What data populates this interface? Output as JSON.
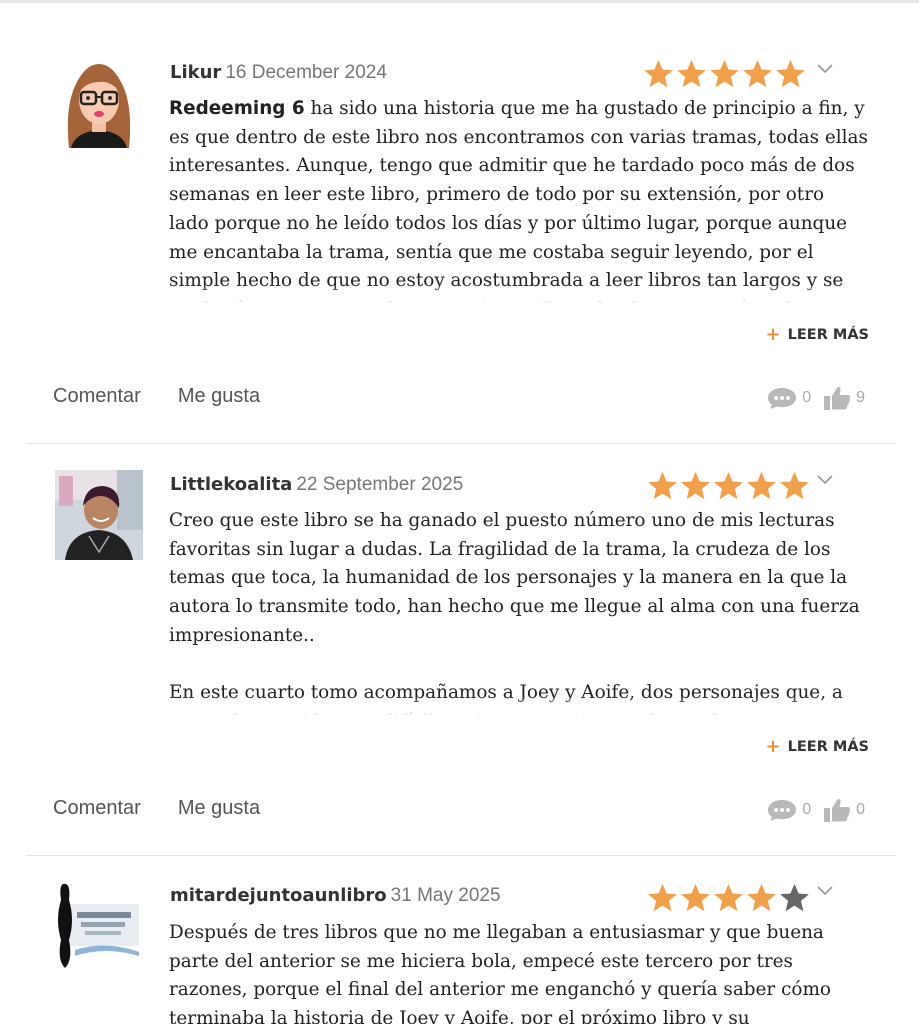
{
  "colors": {
    "star_filled": "#f0a04b",
    "star_empty": "#666666",
    "accent": "#e8913a"
  },
  "reviews": [
    {
      "user": "Likur",
      "date": "16 December 2024",
      "rating": 5,
      "bold_lead": "Redeeming 6",
      "paragraphs": [
        " ha sido una historia que me ha gustado de principio a fin, y es que dentro de este libro nos encontramos con varias tramas, todas ellas interesantes. Aunque, tengo que admitir que he tardado poco más de dos semanas en leer este libro, primero de todo por su extensión, por otro lado porque no he leído todos los días y por último lugar, porque aunque me encantaba la trama, sentía que me costaba seguir leyendo, por el simple hecho de que no estoy acostumbrada a leer libros tan largos y se me hacía un poco pesado en ocasiones. De todas formas, a mí me ha gustado mucho el libro."
      ],
      "read_more": "LEER MÁS",
      "comment_label": "Comentar",
      "like_label": "Me gusta",
      "comments": "0",
      "likes": "9"
    },
    {
      "user": "Littlekoalita",
      "date": "22 September 2025",
      "rating": 5,
      "bold_lead": "",
      "paragraphs": [
        "Creo que este libro se ha ganado el puesto número uno de mis lecturas favoritas sin lugar a dudas. La fragilidad de la trama, la crudeza de los temas que toca, la humanidad de los personajes y la manera en la que la autora lo transmite todo, han hecho que me llegue al alma con una fuerza impresionante..",
        "En este cuarto tomo acompañamos a Joey y Aoife, dos personajes que, a pesar de sus vidas tan difíciles, siempre se tienen el uno al otro."
      ],
      "read_more": "LEER MÁS",
      "comment_label": "Comentar",
      "like_label": "Me gusta",
      "comments": "0",
      "likes": "0"
    },
    {
      "user": "mitardejuntoaunlibro",
      "date": "31 May 2025",
      "rating": 4,
      "bold_lead": "",
      "paragraphs": [
        "Después de tres libros que no me llegaban a entusiasmar y que buena parte del anterior se me hiciera bola, empecé este tercero por tres razones, porque el final del anterior me enganchó y quería saber cómo terminaba la historia de Joey y Aoife, por el próximo libro y su continuación (que salió"
      ]
    }
  ]
}
